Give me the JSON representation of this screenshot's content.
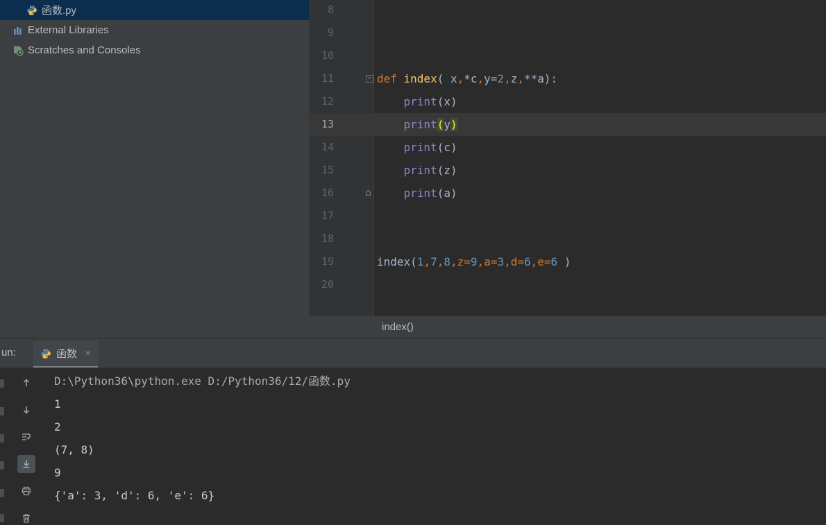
{
  "colors": {
    "selection_blue": "#0b2e4e",
    "panel_bg": "#3c3f41",
    "editor_bg": "#2b2b2b",
    "current_line": "#383838",
    "keyword": "#cc7832",
    "function_name": "#ffc66d",
    "number": "#6897bb",
    "builtin": "#8888c6",
    "brace_match": "#ffef28"
  },
  "project_panel": {
    "items": [
      {
        "label": "函数.py",
        "icon": "python-file-icon",
        "selected": true,
        "indent": 1
      },
      {
        "label": "External Libraries",
        "icon": "external-libraries-icon",
        "selected": false,
        "indent": 0
      },
      {
        "label": "Scratches and Consoles",
        "icon": "scratches-icon",
        "selected": false,
        "indent": 0
      }
    ]
  },
  "editor": {
    "breadcrumb": "index()",
    "lines": [
      {
        "num": 8,
        "tokens": []
      },
      {
        "num": 9,
        "tokens": []
      },
      {
        "num": 10,
        "tokens": []
      },
      {
        "num": 11,
        "fold": "collapse",
        "tokens": [
          {
            "t": "def ",
            "c": "kw"
          },
          {
            "t": "index",
            "c": "fn"
          },
          {
            "t": "( x",
            "c": "plain"
          },
          {
            "t": ",",
            "c": "comma"
          },
          {
            "t": "*c",
            "c": "plain"
          },
          {
            "t": ",",
            "c": "comma"
          },
          {
            "t": "y=",
            "c": "plain"
          },
          {
            "t": "2",
            "c": "num"
          },
          {
            "t": ",",
            "c": "comma"
          },
          {
            "t": "z",
            "c": "plain"
          },
          {
            "t": ",",
            "c": "comma"
          },
          {
            "t": "**a):",
            "c": "plain"
          }
        ]
      },
      {
        "num": 12,
        "tokens": [
          {
            "t": "    ",
            "c": "plain"
          },
          {
            "t": "print",
            "c": "builtin"
          },
          {
            "t": "(x)",
            "c": "plain"
          }
        ]
      },
      {
        "num": 13,
        "current": true,
        "tokens": [
          {
            "t": "    ",
            "c": "plain"
          },
          {
            "t": "print",
            "c": "builtin"
          },
          {
            "t": "(",
            "c": "brace"
          },
          {
            "t": "y",
            "c": "plain"
          },
          {
            "t": ")",
            "c": "brace"
          }
        ]
      },
      {
        "num": 14,
        "tokens": [
          {
            "t": "    ",
            "c": "plain"
          },
          {
            "t": "print",
            "c": "builtin"
          },
          {
            "t": "(c)",
            "c": "plain"
          }
        ]
      },
      {
        "num": 15,
        "tokens": [
          {
            "t": "    ",
            "c": "plain"
          },
          {
            "t": "print",
            "c": "builtin"
          },
          {
            "t": "(z)",
            "c": "plain"
          }
        ]
      },
      {
        "num": 16,
        "fold": "end",
        "tokens": [
          {
            "t": "    ",
            "c": "plain"
          },
          {
            "t": "print",
            "c": "builtin"
          },
          {
            "t": "(a)",
            "c": "plain"
          }
        ]
      },
      {
        "num": 17,
        "tokens": []
      },
      {
        "num": 18,
        "tokens": []
      },
      {
        "num": 19,
        "tokens": [
          {
            "t": "index(",
            "c": "plain"
          },
          {
            "t": "1",
            "c": "num"
          },
          {
            "t": ",",
            "c": "comma"
          },
          {
            "t": "7",
            "c": "num"
          },
          {
            "t": ",",
            "c": "comma"
          },
          {
            "t": "8",
            "c": "num"
          },
          {
            "t": ",",
            "c": "comma"
          },
          {
            "t": "z=",
            "c": "arg"
          },
          {
            "t": "9",
            "c": "num"
          },
          {
            "t": ",",
            "c": "comma"
          },
          {
            "t": "a=",
            "c": "arg"
          },
          {
            "t": "3",
            "c": "num"
          },
          {
            "t": ",",
            "c": "comma"
          },
          {
            "t": "d=",
            "c": "arg"
          },
          {
            "t": "6",
            "c": "num"
          },
          {
            "t": ",",
            "c": "comma"
          },
          {
            "t": "e=",
            "c": "arg"
          },
          {
            "t": "6",
            "c": "num"
          },
          {
            "t": " )",
            "c": "plain"
          }
        ]
      },
      {
        "num": 20,
        "tokens": []
      }
    ]
  },
  "run_panel": {
    "window_label": "un:",
    "tab": {
      "icon": "python-icon",
      "title": "函数",
      "close_label": "×"
    },
    "toolbar_icons": [
      {
        "icon": "up-arrow-icon",
        "pressed": false
      },
      {
        "icon": "down-arrow-icon",
        "pressed": false
      },
      {
        "icon": "soft-wrap-icon",
        "pressed": false
      },
      {
        "icon": "scroll-to-end-icon",
        "pressed": true
      },
      {
        "icon": "print-icon",
        "pressed": false
      },
      {
        "icon": "clear-icon",
        "pressed": false
      }
    ],
    "console_lines": [
      {
        "text": "D:\\Python36\\python.exe D:/Python36/12/函数.py",
        "c": "cmd"
      },
      {
        "text": "1",
        "c": "out"
      },
      {
        "text": "2",
        "c": "out"
      },
      {
        "text": "(7, 8)",
        "c": "out"
      },
      {
        "text": "9",
        "c": "out"
      },
      {
        "text": "{'a': 3, 'd': 6, 'e': 6}",
        "c": "out"
      }
    ]
  }
}
